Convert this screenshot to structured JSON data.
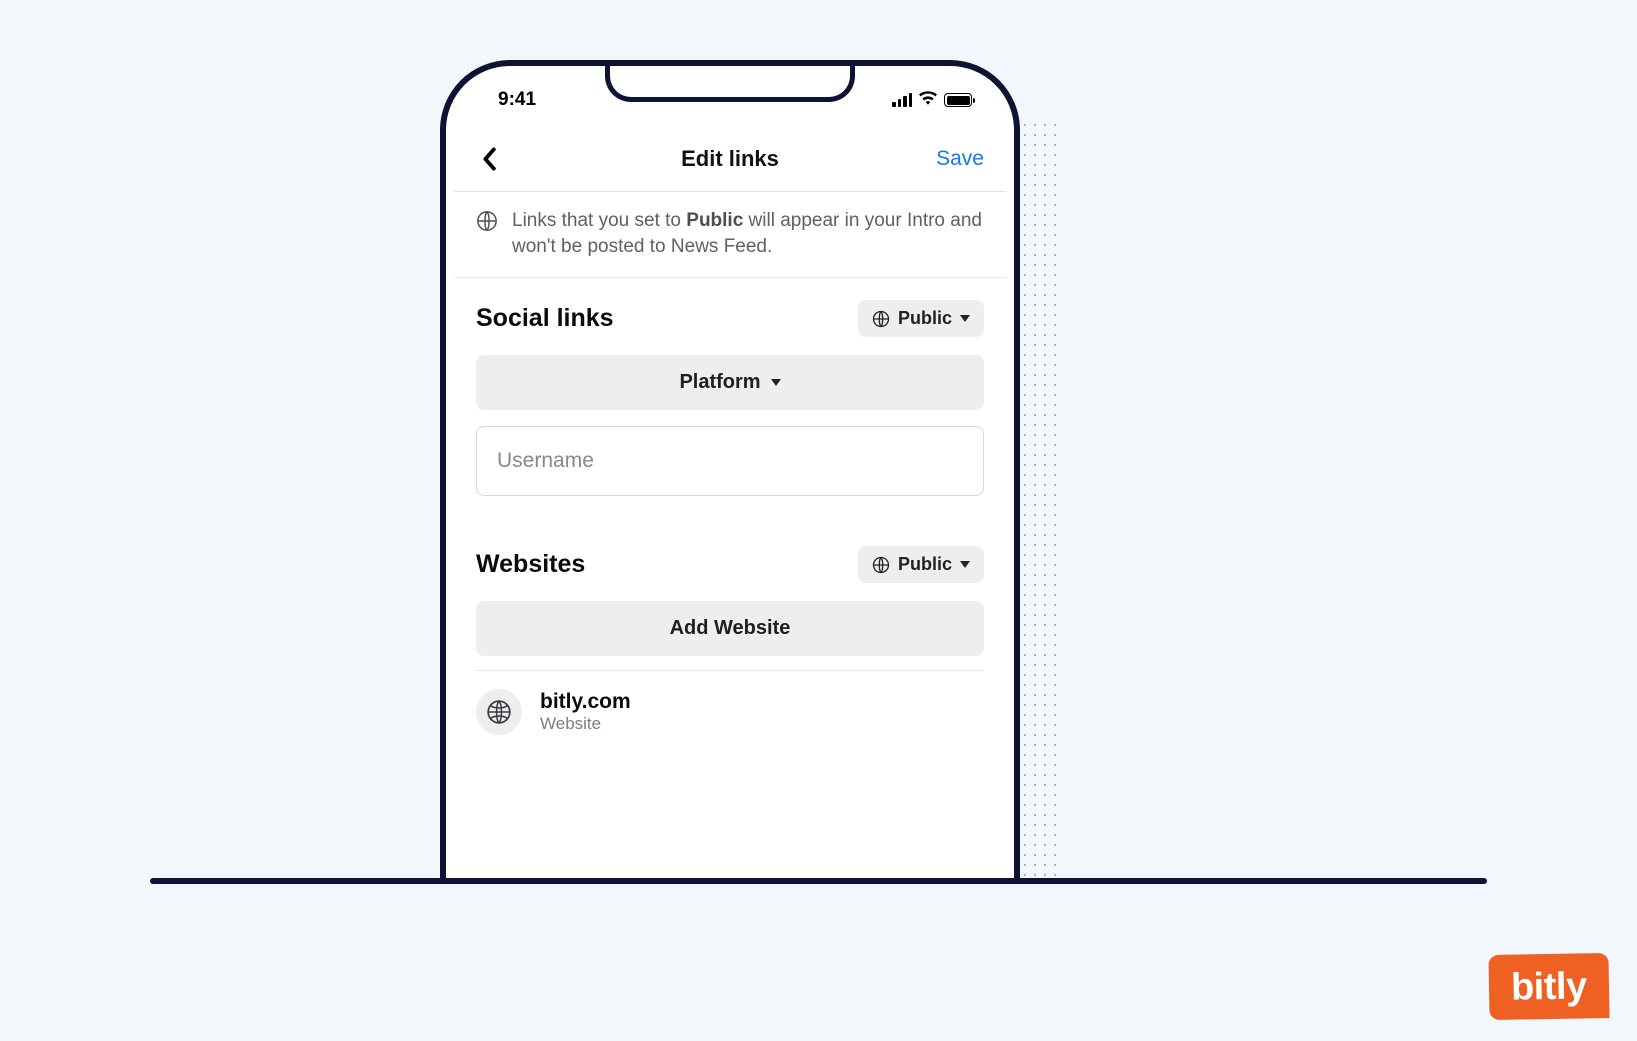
{
  "status": {
    "time": "9:41"
  },
  "nav": {
    "title": "Edit links",
    "save": "Save"
  },
  "banner": {
    "prefix": "Links that you set to ",
    "bold": "Public",
    "suffix": " will appear in your Intro and won't be posted to News Feed."
  },
  "social": {
    "heading": "Social links",
    "privacy": "Public",
    "platform_label": "Platform",
    "username_placeholder": "Username"
  },
  "websites": {
    "heading": "Websites",
    "privacy": "Public",
    "add_label": "Add Website",
    "items": [
      {
        "url": "bitly.com",
        "type": "Website"
      }
    ]
  },
  "brand": {
    "name": "bitly"
  }
}
